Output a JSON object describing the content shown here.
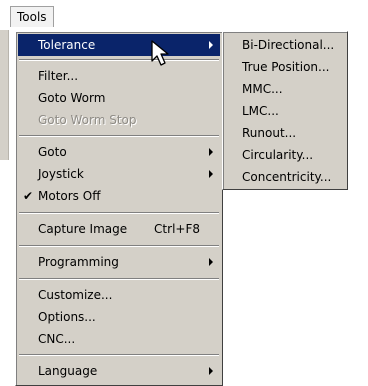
{
  "menubar": {
    "tools_label": "Tools"
  },
  "menu": {
    "tolerance": "Tolerance",
    "filter": "Filter...",
    "goto_worm": "Goto Worm",
    "goto_worm_stop": "Goto Worm Stop",
    "goto": "Goto",
    "joystick": "Joystick",
    "motors_off": "Motors Off",
    "motors_off_check": "✔",
    "capture_image": "Capture Image",
    "capture_image_shortcut": "Ctrl+F8",
    "programming": "Programming",
    "customize": "Customize...",
    "options": "Options...",
    "cnc": "CNC...",
    "language": "Language"
  },
  "submenu": {
    "items": [
      "Bi-Directional...",
      "True Position...",
      "MMC...",
      "LMC...",
      "Runout...",
      "Circularity...",
      "Concentricity..."
    ]
  },
  "colors": {
    "menu_bg": "#d4d0c8",
    "highlight": "#0a246a",
    "disabled_text": "#8f8c86"
  },
  "icons": {
    "cursor": "mouse-pointer-icon",
    "submenu": "submenu-arrow-icon",
    "check": "check-icon"
  }
}
